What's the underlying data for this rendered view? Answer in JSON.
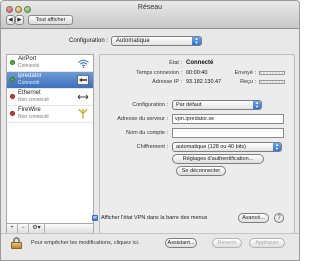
{
  "window": {
    "title": "Réseau"
  },
  "toolbar": {
    "back_label": "◀",
    "forward_label": "▶",
    "show_all_label": "Tout afficher"
  },
  "location": {
    "label": "Configuration :",
    "value": "Automatique"
  },
  "services": [
    {
      "name": "AirPort",
      "status": "Connecté",
      "dot_color": "#4fb33a",
      "icon": "wifi-icon",
      "selected": false
    },
    {
      "name": "ipredator",
      "status": "Connecté",
      "dot_color": "#4fb33a",
      "icon": "vpn-icon",
      "selected": true
    },
    {
      "name": "Ethernet",
      "status": "Non connecté",
      "dot_color": "#d33a2f",
      "icon": "ethernet-icon",
      "selected": false
    },
    {
      "name": "FireWire",
      "status": "Non connecté",
      "dot_color": "#d33a2f",
      "icon": "firewire-icon",
      "selected": false
    }
  ],
  "list_tools": {
    "add": "+",
    "remove": "−",
    "gear": "⚙▾"
  },
  "detail": {
    "status_label": "État :",
    "status_value": "Connecté",
    "time_label": "Temps connexion :",
    "time_value": "00:00:40",
    "ip_label": "Adresse IP :",
    "ip_value": "93.182.130.47",
    "sent_label": "Envoyé :",
    "received_label": "Reçu :",
    "configuration_label": "Configuration :",
    "configuration_value": "Par défaut",
    "server_label": "Adresse du serveur :",
    "server_value": "vpn.ipredator.se",
    "account_label": "Nom du compte :",
    "account_value": "",
    "encryption_label": "Chiffrement :",
    "encryption_value": "automatique (128 ou 40 bits)",
    "auth_button": "Réglages d'authentification...",
    "disconnect_button": "Se déconnecter"
  },
  "vpn_menu_checkbox": {
    "label": "Afficher l'état VPN dans la barre des menus",
    "checked": true,
    "mark": "✓"
  },
  "advanced_button": "Avancé...",
  "help_button": "?",
  "footer": {
    "lock_text": "Pour empêcher les modifications, cliquez ici.",
    "assistant_button": "Assistant...",
    "revert_button": "Revenir",
    "apply_button": "Appliquer"
  }
}
